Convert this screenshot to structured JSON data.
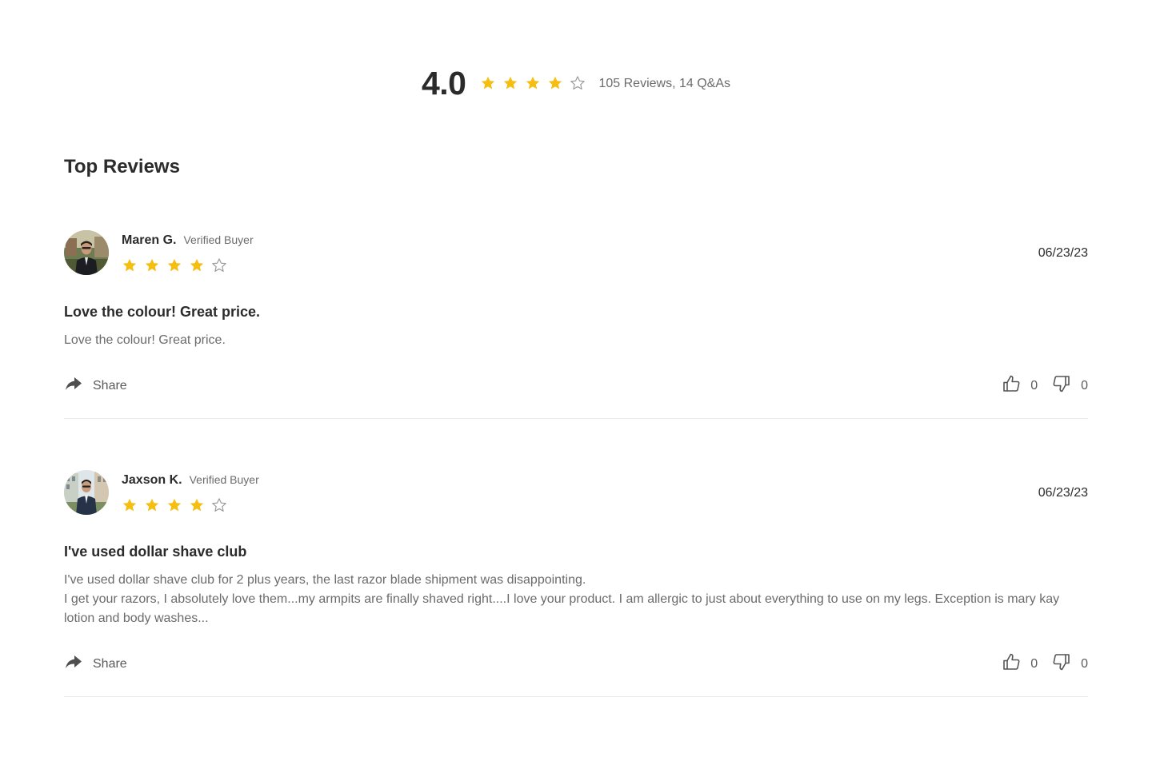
{
  "summary": {
    "average": "4.0",
    "rating": 4,
    "max_rating": 5,
    "counts_text": "105 Reviews, 14 Q&As"
  },
  "section_title": "Top Reviews",
  "colors": {
    "star_filled": "#F5BE10",
    "star_empty": "#9a9a9a",
    "text_primary": "#2b2b2b",
    "text_secondary": "#6b6b6b",
    "divider": "#e9e9e9"
  },
  "reviews": [
    {
      "author": "Maren G.",
      "badge": "Verified Buyer",
      "rating": 4,
      "date": "06/23/23",
      "title": "Love the colour! Great price.",
      "body_lines": [
        "Love the colour! Great price."
      ],
      "share_label": "Share",
      "likes": "0",
      "dislikes": "0"
    },
    {
      "author": "Jaxson K.",
      "badge": "Verified Buyer",
      "rating": 4,
      "date": "06/23/23",
      "title": "I've used dollar shave club",
      "body_lines": [
        "I've used dollar shave club for 2 plus years, the last razor blade shipment was disappointing.",
        "I get your razors, I absolutely love them...my armpits are finally shaved right....I love your product. I am allergic to just about everything to use on my legs. Exception is mary kay lotion and body washes..."
      ],
      "share_label": "Share",
      "likes": "0",
      "dislikes": "0"
    }
  ],
  "icons": {
    "star_filled": "star-filled-icon",
    "star_empty": "star-outline-icon",
    "share": "share-arrow-icon",
    "like": "thumbs-up-icon",
    "dislike": "thumbs-down-icon"
  }
}
